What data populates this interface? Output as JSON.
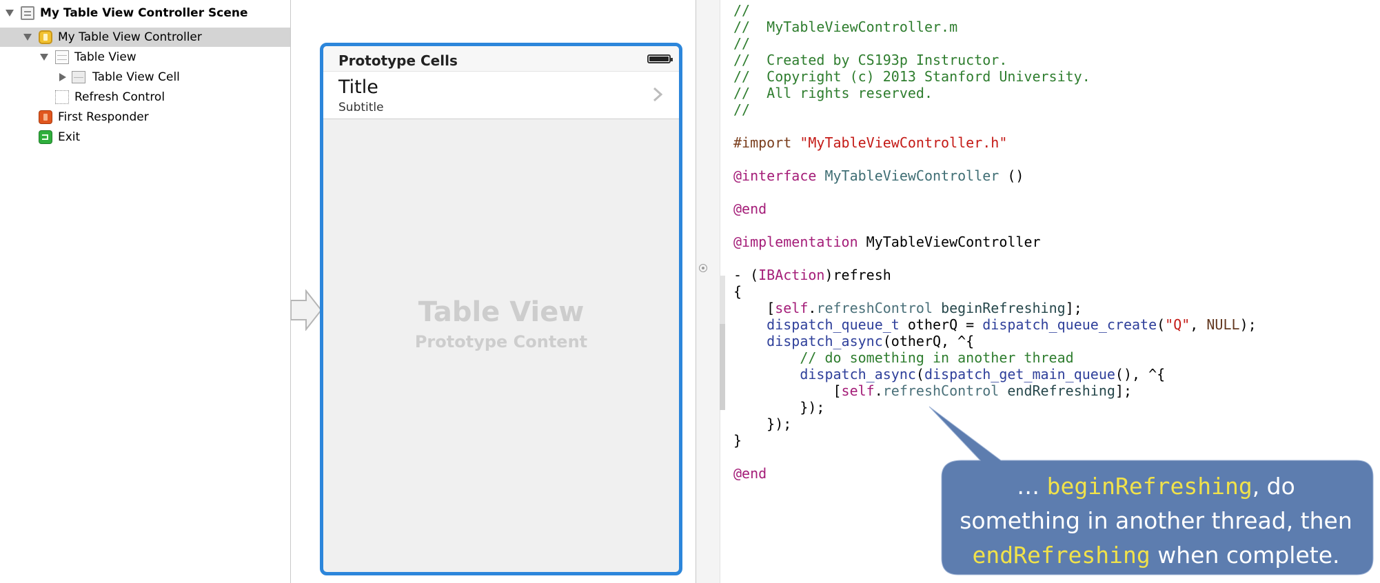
{
  "outline": {
    "items": [
      {
        "label": "My Table View Controller Scene",
        "icon": "storyboard-scene-icon",
        "disclosure": "down",
        "bold": true,
        "selected": false
      },
      {
        "label": "My Table View Controller",
        "icon": "view-controller-icon",
        "disclosure": "down",
        "bold": false,
        "selected": true
      },
      {
        "label": "Table View",
        "icon": "table-view-icon",
        "disclosure": "down",
        "bold": false,
        "selected": false
      },
      {
        "label": "Table View Cell",
        "icon": "table-view-cell-icon",
        "disclosure": "right",
        "bold": false,
        "selected": false
      },
      {
        "label": "Refresh Control",
        "icon": "refresh-control-icon",
        "disclosure": "none",
        "bold": false,
        "selected": false
      },
      {
        "label": "First Responder",
        "icon": "first-responder-icon",
        "disclosure": "none",
        "bold": false,
        "selected": false
      },
      {
        "label": "Exit",
        "icon": "exit-icon",
        "disclosure": "none",
        "bold": false,
        "selected": false
      }
    ]
  },
  "canvas": {
    "section_header": "Prototype Cells",
    "cell_title": "Title",
    "cell_subtitle": "Subtitle",
    "placeholder_title": "Table View",
    "placeholder_subtitle": "Prototype Content",
    "accent_color": "#2c86db"
  },
  "editor": {
    "lines": [
      "//",
      "//  MyTableViewController.m",
      "//",
      "//  Created by CS193p Instructor.",
      "//  Copyright (c) 2013 Stanford University.",
      "//  All rights reserved.",
      "//",
      "",
      "#import \"MyTableViewController.h\"",
      "",
      "@interface MyTableViewController ()",
      "",
      "@end",
      "",
      "@implementation MyTableViewController",
      "",
      "- (IBAction)refresh",
      "{",
      "    [self.refreshControl beginRefreshing];",
      "    dispatch_queue_t otherQ = dispatch_queue_create(\"Q\", NULL);",
      "    dispatch_async(otherQ, ^{",
      "        // do something in another thread",
      "        dispatch_async(dispatch_get_main_queue(), ^{",
      "            [self.refreshControl endRefreshing];",
      "        });",
      "    });",
      "}",
      "",
      "@end"
    ]
  },
  "callout": {
    "prefix": "… ",
    "highlight1": "beginRefreshing",
    "mid1": ", do",
    "mid2": "something in another thread, then",
    "highlight2": "endRefreshing",
    "suffix": " when complete.",
    "fill_color": "#4f72a8",
    "highlight_color": "#f1e24a"
  }
}
